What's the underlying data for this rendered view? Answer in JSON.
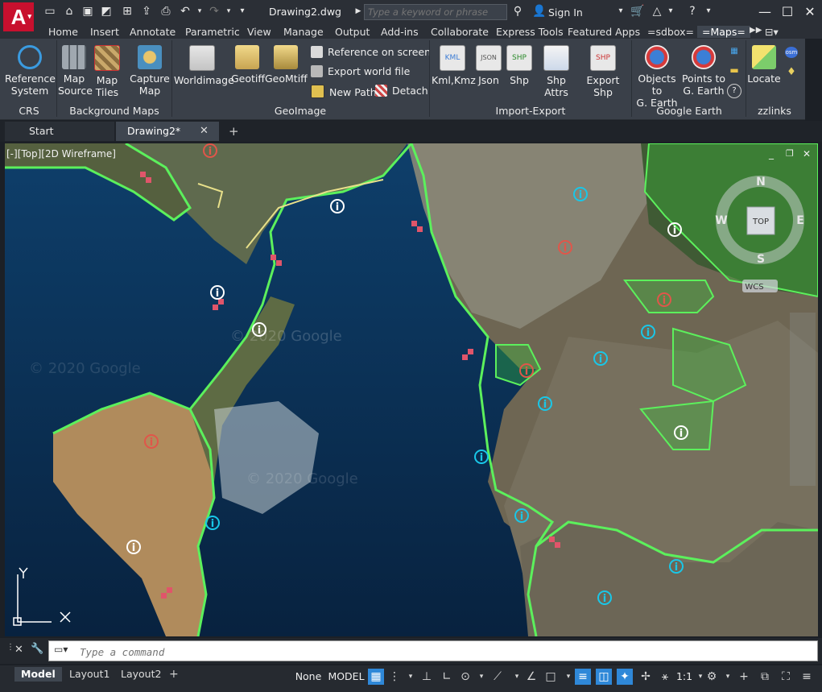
{
  "titlebar": {
    "logo_letter": "A",
    "document_title": "Drawing2.dwg",
    "search_placeholder": "Type a keyword or phrase",
    "sign_in": "Sign In"
  },
  "ribbon_tabs": [
    "Home",
    "Insert",
    "Annotate",
    "Parametric",
    "View",
    "Manage",
    "Output",
    "Add-ins",
    "Collaborate",
    "Express Tools",
    "Featured Apps",
    "=sdbox=",
    "=Maps="
  ],
  "active_tab": "=Maps=",
  "ribbon": {
    "crs": {
      "title": "CRS",
      "reference_system": "Reference\nSystem"
    },
    "background_maps": {
      "title": "Background Maps",
      "map_source": "Map\nSource",
      "map_tiles": "Map\nTiles",
      "capture_map": "Capture\nMap"
    },
    "geoimage": {
      "title": "GeoImage",
      "worldimage": "Worldimage",
      "geotiff": "Geotiff",
      "geomtiff": "GeoMtiff",
      "reference_on_screen": "Reference on screen",
      "export_world_file": "Export world file",
      "new_path": "New Path",
      "detach": "Detach"
    },
    "import_export": {
      "title": "Import-Export",
      "kml": "Kml,Kmz",
      "json": "Json",
      "shp": "Shp",
      "shp_attrs": "Shp Attrs",
      "export_shp": "Export Shp"
    },
    "google_earth": {
      "title": "Google Earth",
      "objects": "Objects to\nG. Earth",
      "points": "Points to\nG. Earth"
    },
    "zzlinks": {
      "title": "zzlinks",
      "locate": "Locate"
    }
  },
  "file_tabs": {
    "start": "Start",
    "drawing": "Drawing2*"
  },
  "viewport": {
    "label": "[-][Top][2D Wireframe]",
    "watermark": "© 2020 Google",
    "viewcube": {
      "top": "TOP",
      "north": "N",
      "south": "S",
      "west": "W",
      "east": "E",
      "wcs": "WCS"
    },
    "ucs": {
      "x": "X",
      "y": "Y"
    }
  },
  "command": {
    "placeholder": "Type a command"
  },
  "layout_tabs": [
    "Model",
    "Layout1",
    "Layout2"
  ],
  "status": {
    "none": "None",
    "model": "MODEL",
    "scale": "1:1"
  },
  "colors": {
    "accent": "#2f88d8",
    "polygon_green": "#4ddc4d",
    "info_white": "#ffffff",
    "info_cyan": "#19c7e8",
    "info_red": "#e0564a"
  }
}
